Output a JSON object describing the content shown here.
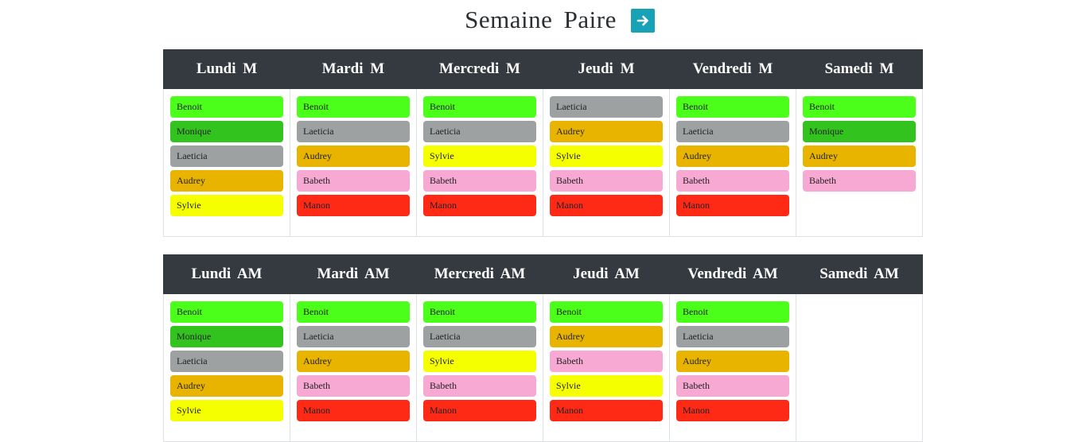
{
  "title": "Semaine Paire",
  "next_icon": "arrow-right-icon",
  "colors": {
    "Benoit": "#4cff1a",
    "Monique": "#33c31f",
    "Laeticia": "#9ea1a2",
    "Audrey": "#e8b400",
    "Sylvie": "#f5ff00",
    "Babeth": "#f8a9d3",
    "Manon": "#ff2a16"
  },
  "morning": {
    "days": [
      {
        "header": "Lundi  M",
        "people": [
          "Benoit",
          "Monique",
          "Laeticia",
          "Audrey",
          "Sylvie"
        ]
      },
      {
        "header": "Mardi  M",
        "people": [
          "Benoit",
          "Laeticia",
          "Audrey",
          "Babeth",
          "Manon"
        ]
      },
      {
        "header": "Mercredi   M",
        "people": [
          "Benoit",
          "Laeticia",
          "Sylvie",
          "Babeth",
          "Manon"
        ]
      },
      {
        "header": "Jeudi  M",
        "people": [
          "Laeticia",
          "Audrey",
          "Sylvie",
          "Babeth",
          "Manon"
        ]
      },
      {
        "header": "Vendredi   M",
        "people": [
          "Benoit",
          "Laeticia",
          "Audrey",
          "Babeth",
          "Manon"
        ]
      },
      {
        "header": "Samedi   M",
        "people": [
          "Benoit",
          "Monique",
          "Audrey",
          "Babeth"
        ]
      }
    ]
  },
  "afternoon": {
    "days": [
      {
        "header": "Lundi  AM",
        "people": [
          "Benoit",
          "Monique",
          "Laeticia",
          "Audrey",
          "Sylvie"
        ]
      },
      {
        "header": "Mardi  AM",
        "people": [
          "Benoit",
          "Laeticia",
          "Audrey",
          "Babeth",
          "Manon"
        ]
      },
      {
        "header": "Mercredi   AM",
        "people": [
          "Benoit",
          "Laeticia",
          "Sylvie",
          "Babeth",
          "Manon"
        ]
      },
      {
        "header": "Jeudi  AM",
        "people": [
          "Benoit",
          "Audrey",
          "Babeth",
          "Sylvie",
          "Manon"
        ]
      },
      {
        "header": "Vendredi   AM",
        "people": [
          "Benoit",
          "Laeticia",
          "Audrey",
          "Babeth",
          "Manon"
        ]
      },
      {
        "header": "Samedi   AM",
        "people": []
      }
    ]
  }
}
